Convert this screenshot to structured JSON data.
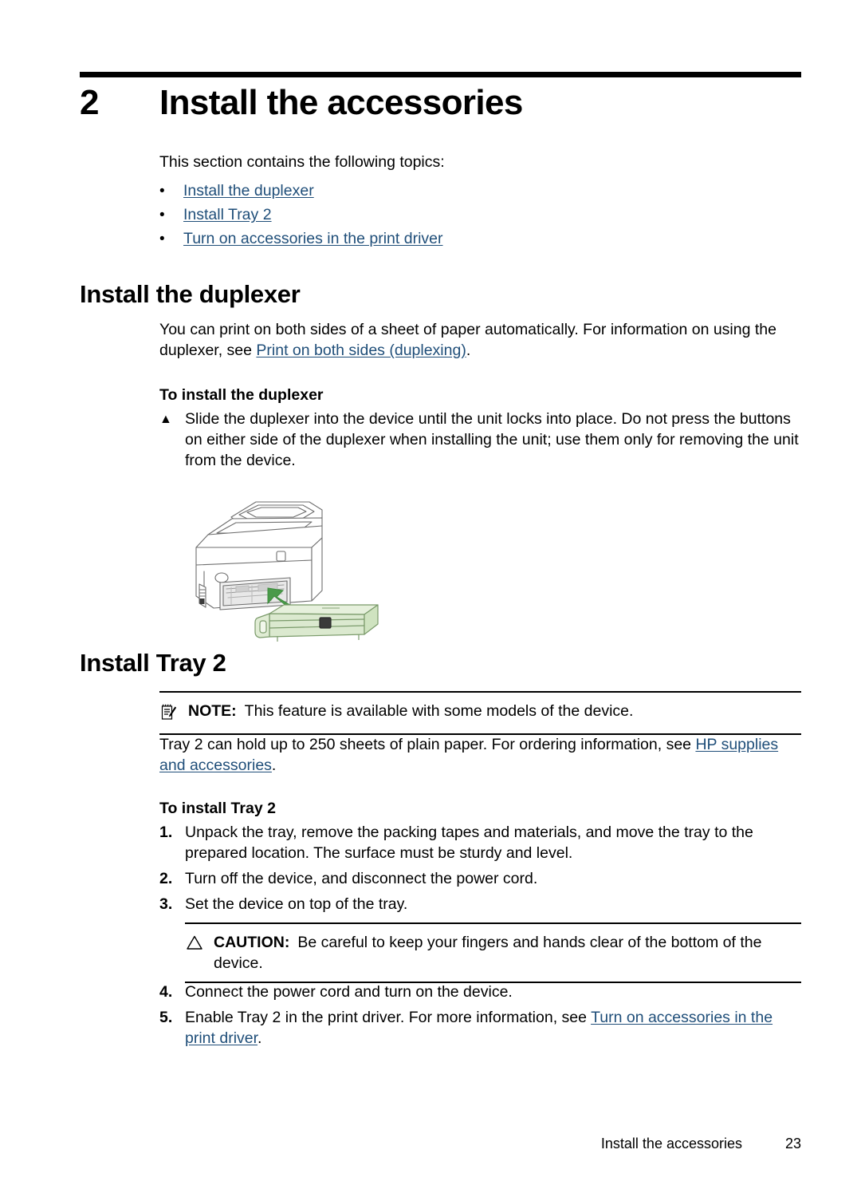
{
  "chapter": {
    "number": "2",
    "title": "Install the accessories"
  },
  "intro": {
    "text": "This section contains the following topics:"
  },
  "toc": {
    "bullet": "•",
    "items": [
      {
        "label": "Install the duplexer"
      },
      {
        "label": "Install Tray 2"
      },
      {
        "label": "Turn on accessories in the print driver"
      }
    ]
  },
  "duplexer_section": {
    "heading": "Install the duplexer",
    "intro_before": "You can print on both sides of a sheet of paper automatically. For information on using the duplexer, see ",
    "intro_link": "Print on both sides (duplexing)",
    "intro_after": ".",
    "procedure_heading": "To install the duplexer",
    "step_bullet": "▲",
    "step_text": "Slide the duplexer into the device until the unit locks into place. Do not press the buttons on either side of the duplexer when installing the unit; use them only for removing the unit from the device.",
    "illustration_name": "printer-with-duplexer-illustration"
  },
  "tray_section": {
    "heading": "Install Tray 2",
    "note": {
      "icon": "note-pad-pencil-icon",
      "label": "NOTE:",
      "text": "This feature is available with some models of the device."
    },
    "intro_before": "Tray 2 can hold up to 250 sheets of plain paper. For ordering information, see ",
    "intro_link": "HP supplies and accessories",
    "intro_after": ".",
    "procedure_heading": "To install Tray 2",
    "steps": [
      {
        "marker": "1.",
        "text": "Unpack the tray, remove the packing tapes and materials, and move the tray to the prepared location. The surface must be sturdy and level."
      },
      {
        "marker": "2.",
        "text": "Turn off the device, and disconnect the power cord."
      },
      {
        "marker": "3.",
        "text": "Set the device on top of the tray."
      }
    ],
    "caution": {
      "icon": "warning-triangle-icon",
      "label": "CAUTION:",
      "text": "Be careful to keep your fingers and hands clear of the bottom of the device."
    },
    "steps_after": [
      {
        "marker": "4.",
        "text": "Connect the power cord and turn on the device."
      },
      {
        "marker": "5.",
        "text_before": "Enable Tray 2 in the print driver. For more information, see ",
        "link": "Turn on accessories in the print driver",
        "text_after": "."
      }
    ]
  },
  "footer": {
    "title": "Install the accessories",
    "page": "23"
  },
  "colors": {
    "link": "#1f4e79",
    "rule": "#000000",
    "duplexer_fill": "#dbe9cf",
    "duplexer_stroke": "#7a9a6a",
    "arrow": "#4a9a4a"
  }
}
